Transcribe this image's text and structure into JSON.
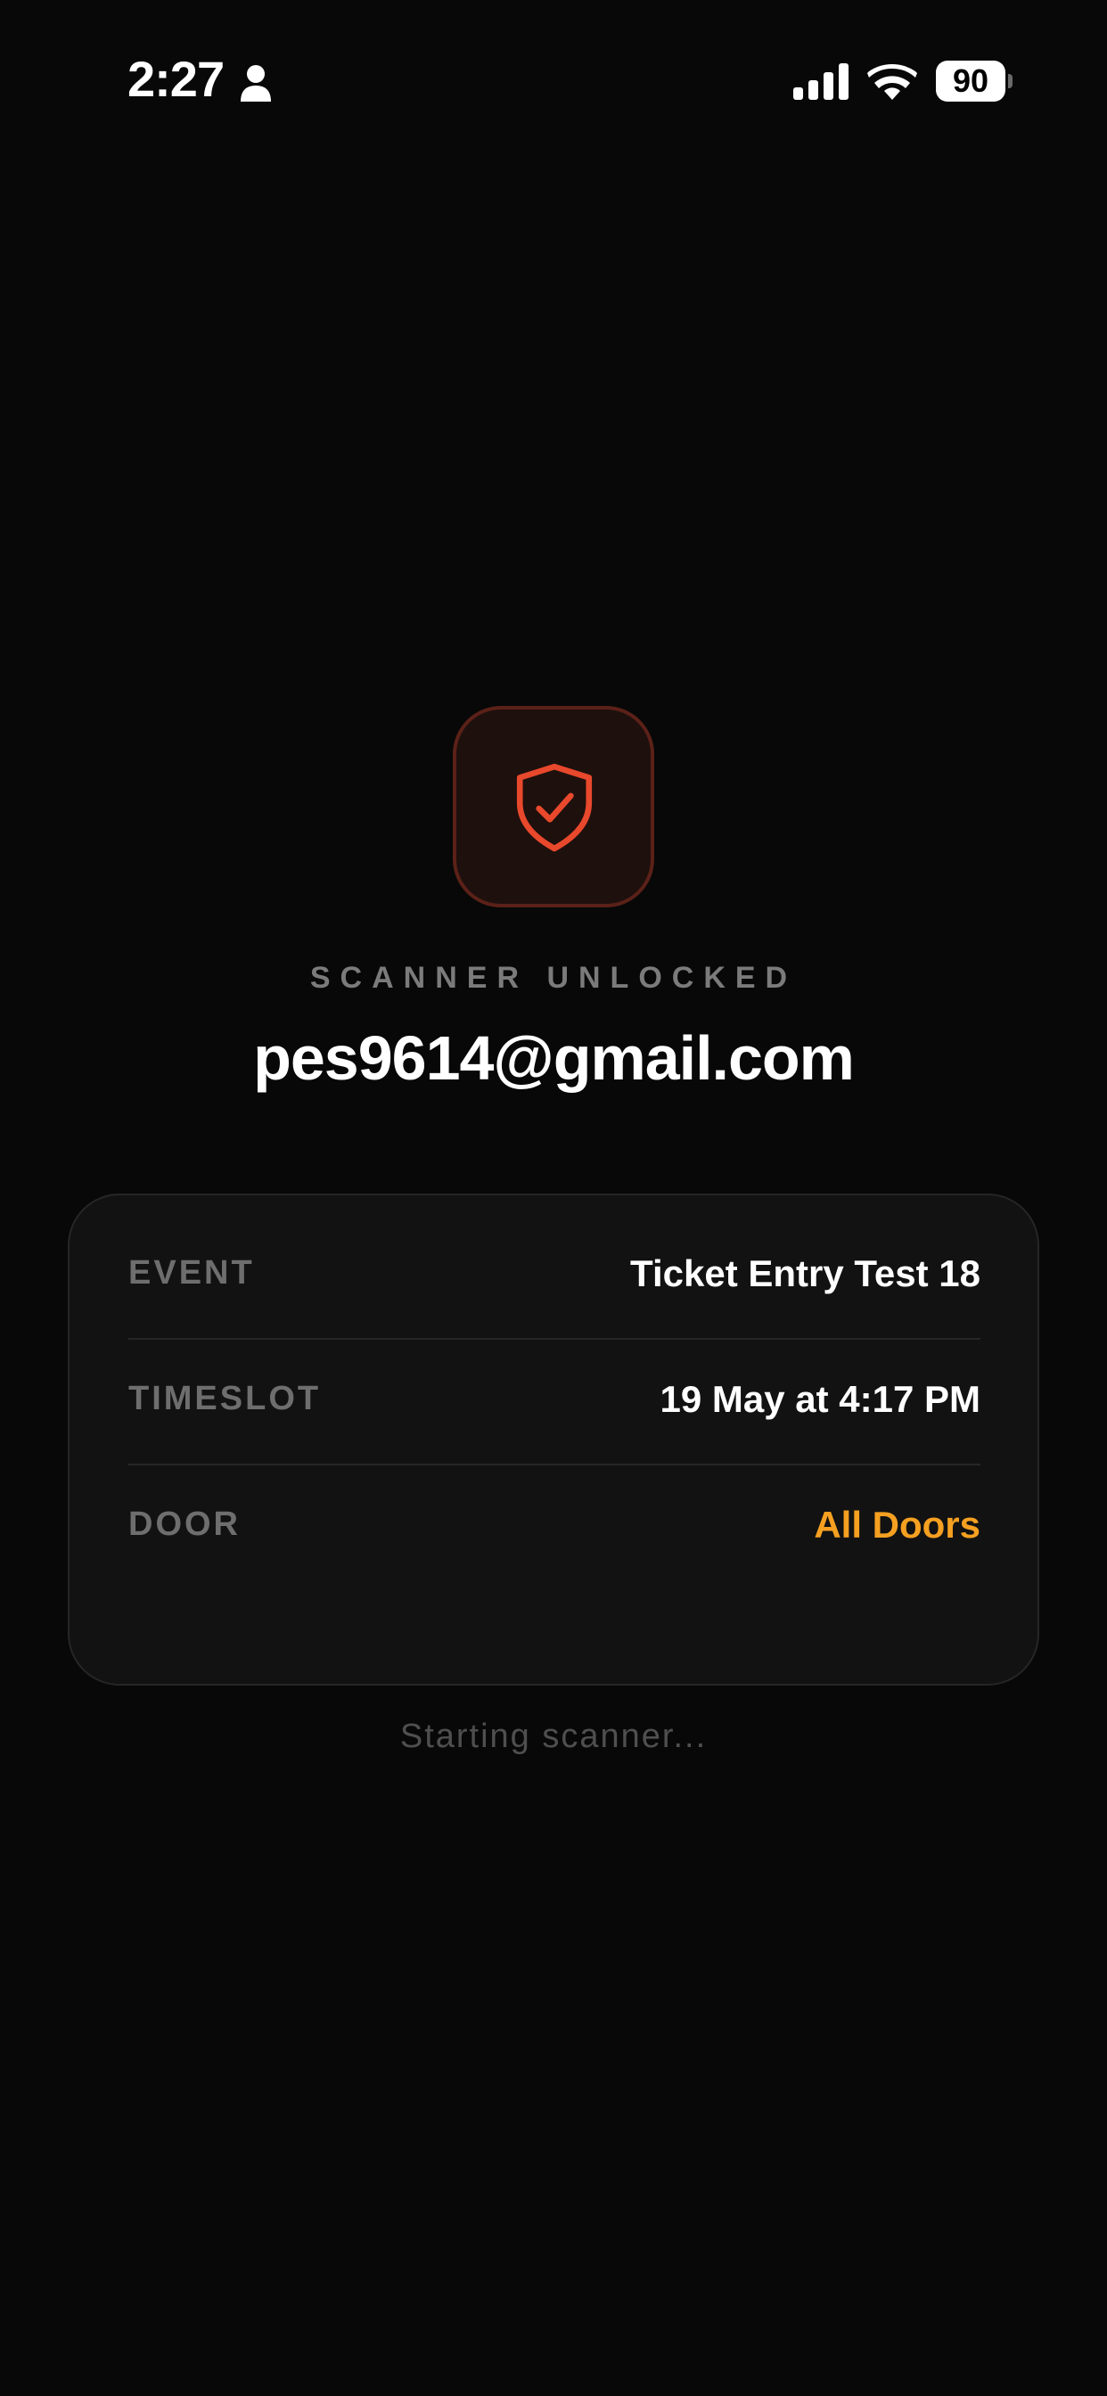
{
  "status_bar": {
    "time": "2:27",
    "battery_level": "90",
    "icons": [
      "person-icon",
      "signal-icon",
      "wifi-icon",
      "battery-icon"
    ]
  },
  "badge": {
    "icon": "shield-check-icon",
    "accent_color": "#e8482c"
  },
  "header": {
    "label": "SCANNER UNLOCKED",
    "email": "pes9614@gmail.com"
  },
  "details": {
    "rows": [
      {
        "label": "EVENT",
        "value": "Ticket Entry Test 18"
      },
      {
        "label": "TIMESLOT",
        "value": "19 May at 4:17 PM"
      },
      {
        "label": "DOOR",
        "value": "All Doors",
        "value_color": "#f5a021"
      }
    ]
  },
  "footer": {
    "status": "Starting scanner..."
  }
}
